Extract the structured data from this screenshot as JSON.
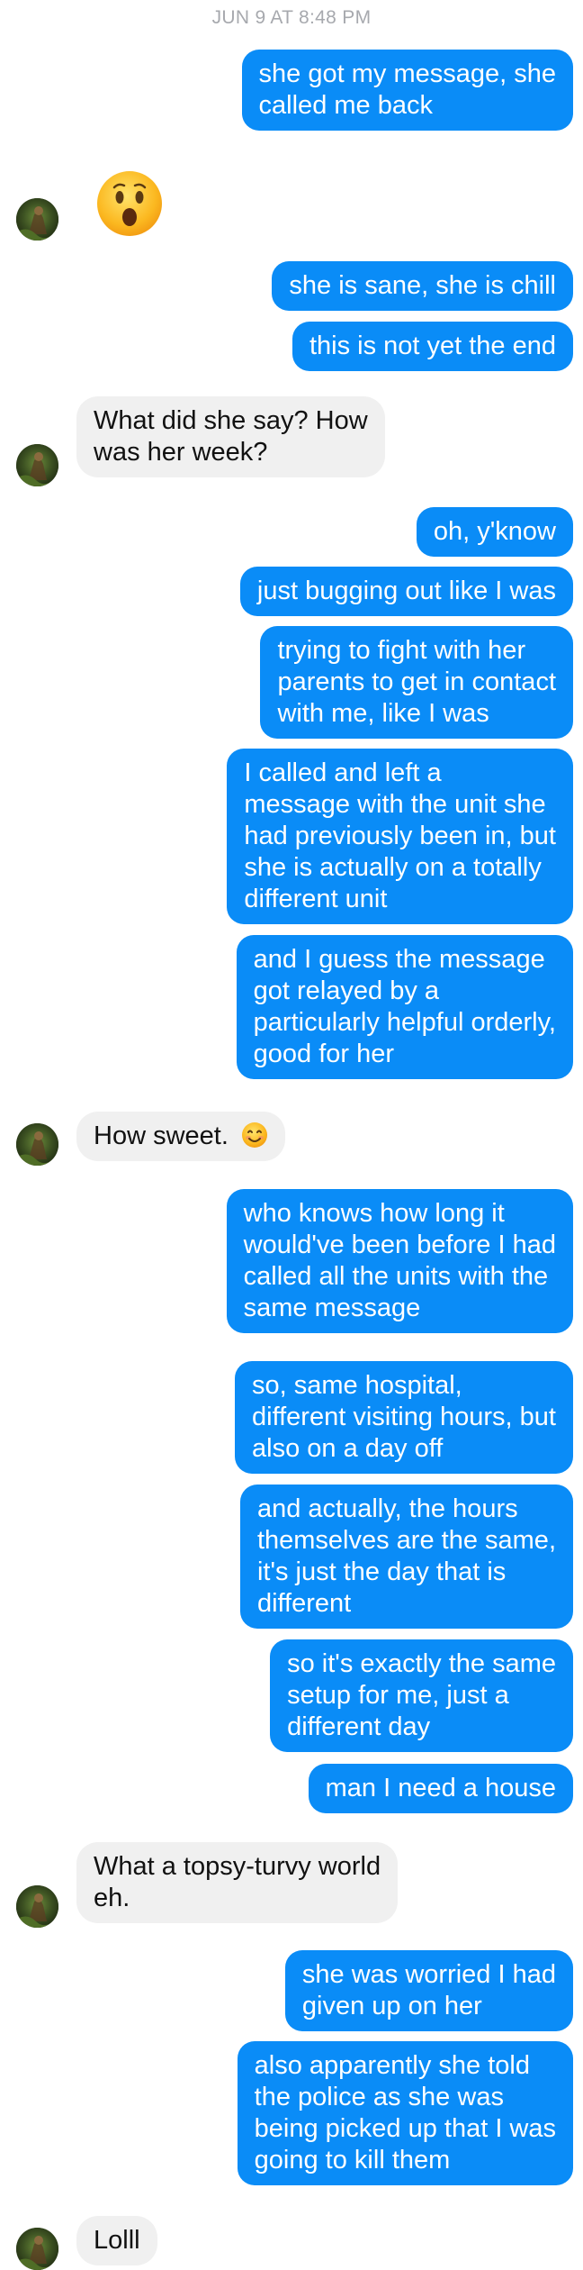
{
  "chat": {
    "timestamp": "JUN 9 AT 8:48 PM",
    "messages": [
      {
        "from": "me",
        "lines": [
          "she got my message, she",
          "called me back"
        ]
      },
      {
        "from": "them",
        "emoji": "surprised-face-emoji"
      },
      {
        "from": "me",
        "lines": [
          "she is sane, she is chill"
        ]
      },
      {
        "from": "me",
        "lines": [
          "this is not yet the end"
        ]
      },
      {
        "from": "them",
        "lines": [
          "What did she say? How",
          "was her week?"
        ]
      },
      {
        "from": "me",
        "lines": [
          "oh, y'know"
        ]
      },
      {
        "from": "me",
        "lines": [
          "just bugging out like I was"
        ]
      },
      {
        "from": "me",
        "lines": [
          "trying to fight with her",
          "parents to get in contact",
          "with me, like I was"
        ]
      },
      {
        "from": "me",
        "lines": [
          "I called and left a",
          "message with the unit she",
          "had previously been in, but",
          "she is actually on a totally",
          "different unit"
        ]
      },
      {
        "from": "me",
        "lines": [
          "and I guess the message",
          "got relayed by a",
          "particularly helpful orderly,",
          "good for her"
        ]
      },
      {
        "from": "them",
        "lines": [
          "How sweet."
        ],
        "emoji": "smiling-face-emoji"
      },
      {
        "from": "me",
        "lines": [
          "who knows how long it",
          "would've been before I had",
          "called all the units with the",
          "same message"
        ]
      },
      {
        "from": "me",
        "lines": [
          "so, same hospital,",
          "different visiting hours, but",
          "also on a day off"
        ]
      },
      {
        "from": "me",
        "lines": [
          "and actually, the hours",
          "themselves are the same,",
          "it's just the day that is",
          "different"
        ]
      },
      {
        "from": "me",
        "lines": [
          "so it's exactly the same",
          "setup for me, just a",
          "different day"
        ]
      },
      {
        "from": "me",
        "lines": [
          "man I need a house"
        ]
      },
      {
        "from": "them",
        "lines": [
          "What a topsy-turvy world",
          "eh."
        ]
      },
      {
        "from": "me",
        "lines": [
          "she was worried I had",
          "given up on her"
        ]
      },
      {
        "from": "me",
        "lines": [
          "also apparently she told",
          "the police as she was",
          "being picked up that I was",
          "going to kill them"
        ]
      },
      {
        "from": "them",
        "lines": [
          "Lolll"
        ]
      }
    ]
  },
  "colors": {
    "outgoing_bubble": "#0a8cf7",
    "incoming_bubble": "#f0f0f0",
    "timestamp_text": "#a7a9ae"
  }
}
